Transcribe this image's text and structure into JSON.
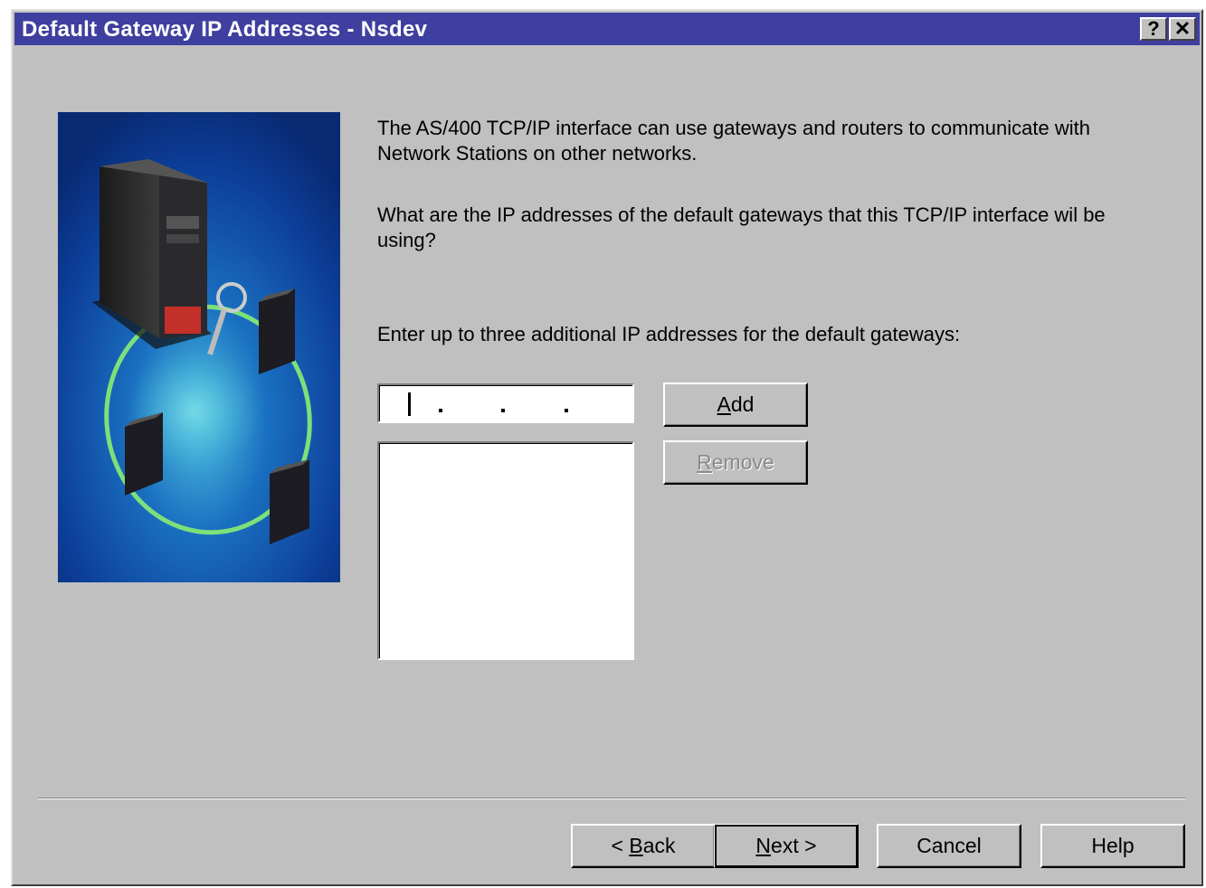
{
  "window": {
    "title": "Default Gateway IP Addresses - Nsdev",
    "help_glyph": "?",
    "close_glyph": "✕"
  },
  "content": {
    "paragraph1": "The AS/400 TCP/IP interface can use gateways and routers to communicate with Network Stations on other networks.",
    "paragraph2": "What are the IP addresses of the default gateways that this TCP/IP interface wil be using?",
    "instruction": "Enter up to three additional  IP addresses for the default gateways:"
  },
  "ip_entry": {
    "value": ""
  },
  "gateway_list": {
    "items": []
  },
  "buttons": {
    "add": {
      "prefix": "",
      "mnemonic": "A",
      "rest": "dd"
    },
    "remove": {
      "prefix": "",
      "mnemonic": "R",
      "rest": "emove",
      "enabled": false
    },
    "back": {
      "prefix": "< ",
      "mnemonic": "B",
      "rest": "ack"
    },
    "next": {
      "prefix": "",
      "mnemonic": "N",
      "rest": "ext >"
    },
    "cancel": "Cancel",
    "help": "Help"
  },
  "colors": {
    "titlebar": "#3f3fa0",
    "dialog_face": "#c0c0c0"
  }
}
